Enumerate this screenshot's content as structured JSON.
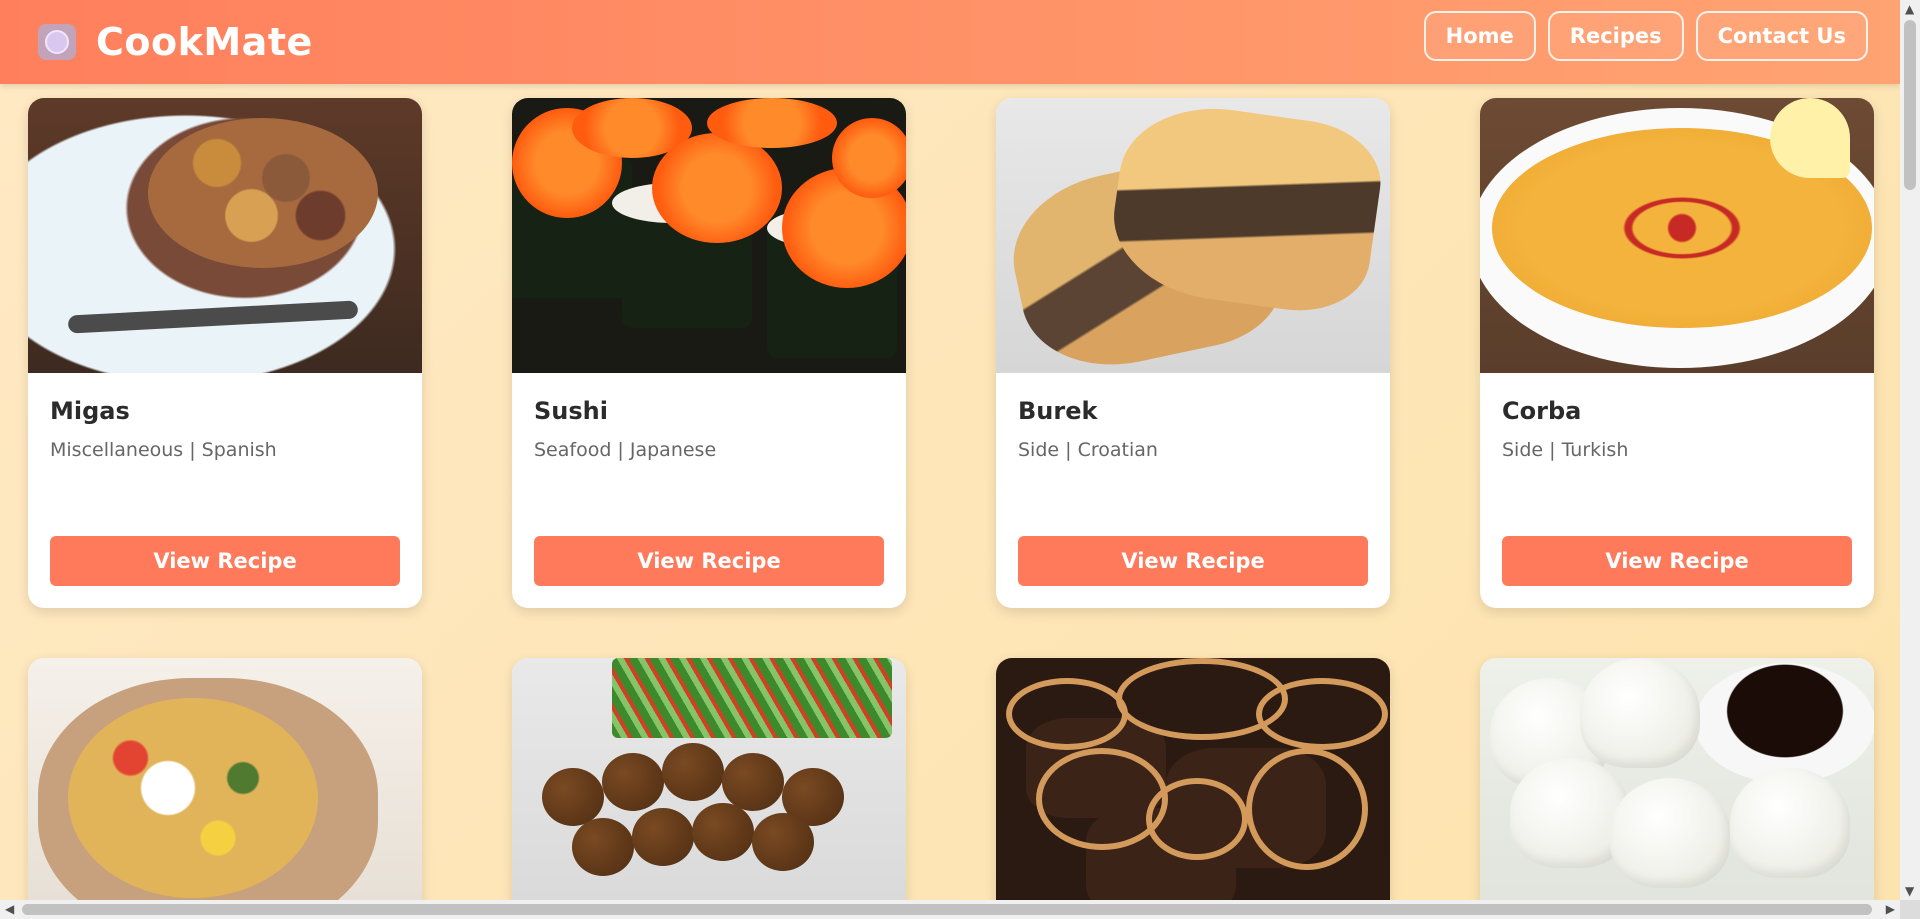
{
  "header": {
    "logo_icon": "plate-icon",
    "brand": "CookMate",
    "nav": [
      {
        "label": "Home"
      },
      {
        "label": "Recipes"
      },
      {
        "label": "Contact Us"
      }
    ]
  },
  "recipes": [
    {
      "title": "Migas",
      "meta": "Miscellaneous | Spanish",
      "button": "View Recipe"
    },
    {
      "title": "Sushi",
      "meta": "Seafood | Japanese",
      "button": "View Recipe"
    },
    {
      "title": "Burek",
      "meta": "Side | Croatian",
      "button": "View Recipe"
    },
    {
      "title": "Corba",
      "meta": "Side | Turkish",
      "button": "View Recipe"
    }
  ],
  "colors": {
    "header_start": "#ff7f5c",
    "header_end": "#ffa372",
    "page_bg": "#ffe9c4",
    "button": "#ff7a5a"
  }
}
